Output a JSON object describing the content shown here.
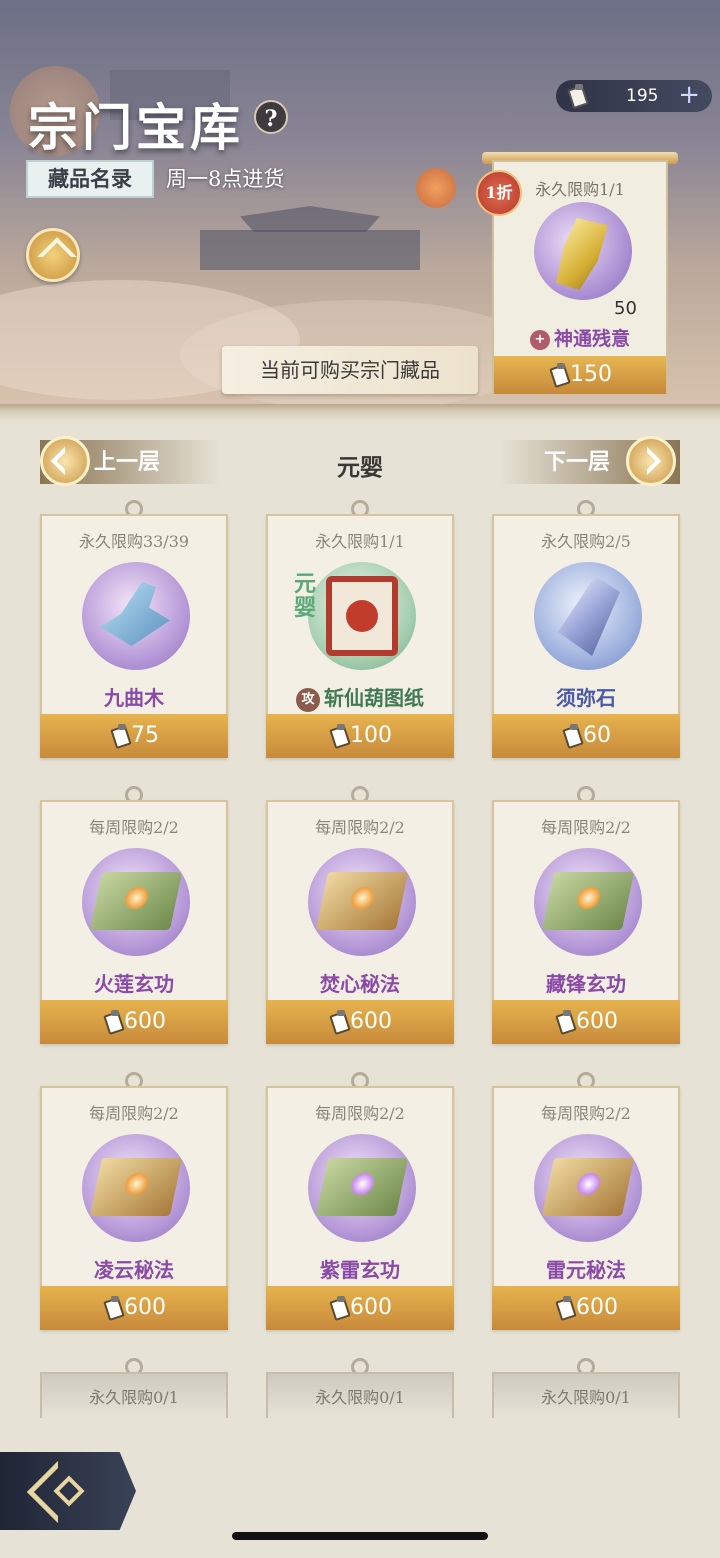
{
  "header": {
    "title": "宗门宝库",
    "help": "?",
    "catalog_label": "藏品名录",
    "restock_info": "周一8点进货",
    "now_buy_label": "当前可购买宗门藏品"
  },
  "currency": {
    "amount": "195",
    "plus": "+"
  },
  "featured": {
    "discount": "1折",
    "limit": "永久限购1/1",
    "count": "50",
    "name": "神通残意",
    "price": "150",
    "name_color": "#8a4aa8"
  },
  "floor": {
    "prev_label": "上一层",
    "current": "元婴",
    "next_label": "下一层"
  },
  "items": [
    {
      "limit": "永久限购33/39",
      "name": "九曲木",
      "price": "75",
      "color": "#8a4aa8",
      "icon": "wood-icon"
    },
    {
      "limit": "永久限购1/1",
      "name": "斩仙葫图纸",
      "price": "100",
      "color": "#3f7a52",
      "icon": "blueprint-scroll-icon",
      "tag": "元婴",
      "prefix": "攻"
    },
    {
      "limit": "永久限购2/5",
      "name": "须弥石",
      "price": "60",
      "color": "#4a5aa8",
      "icon": "crystal-icon"
    },
    {
      "limit": "每周限购2/2",
      "name": "火莲玄功",
      "price": "600",
      "color": "#8a4aa8",
      "icon": "manual-icon"
    },
    {
      "limit": "每周限购2/2",
      "name": "焚心秘法",
      "price": "600",
      "color": "#8a4aa8",
      "icon": "manual-icon"
    },
    {
      "limit": "每周限购2/2",
      "name": "藏锋玄功",
      "price": "600",
      "color": "#8a4aa8",
      "icon": "manual-icon"
    },
    {
      "limit": "每周限购2/2",
      "name": "凌云秘法",
      "price": "600",
      "color": "#8a4aa8",
      "icon": "manual-icon"
    },
    {
      "limit": "每周限购2/2",
      "name": "紫雷玄功",
      "price": "600",
      "color": "#8a4aa8",
      "icon": "manual-icon"
    },
    {
      "limit": "每周限购2/2",
      "name": "雷元秘法",
      "price": "600",
      "color": "#8a4aa8",
      "icon": "manual-icon"
    }
  ],
  "next_row": [
    {
      "limit": "永久限购0/1"
    },
    {
      "limit": "永久限购0/1"
    },
    {
      "limit": "永久限购0/1"
    }
  ]
}
